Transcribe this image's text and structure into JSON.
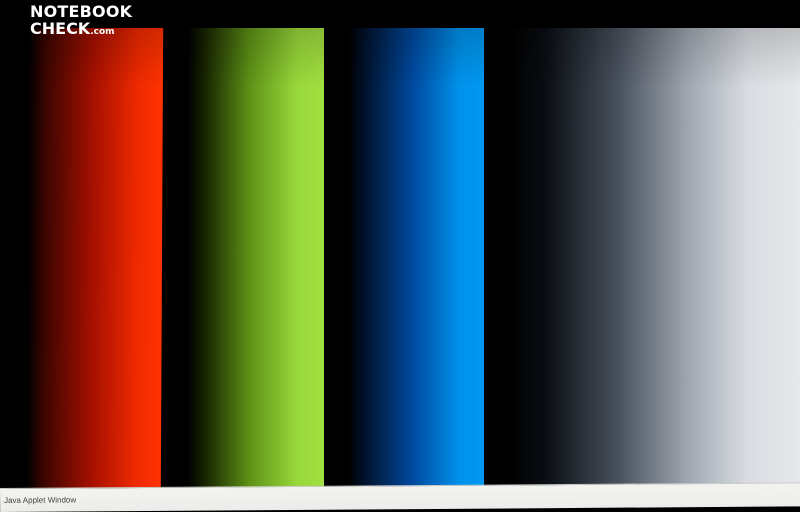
{
  "logo": {
    "line1": "NOTEBOOK",
    "line2": "CHECK",
    "tld": ".com"
  },
  "status_bar": {
    "text": "Java Applet Window"
  },
  "colors": {
    "background": "#000000",
    "red_bar": "#ff3300",
    "green_bar": "#a2e040",
    "blue_bar": "#0099f2",
    "gray_bar": "#e7e9ec",
    "status_bar": "#f0f0ee"
  }
}
